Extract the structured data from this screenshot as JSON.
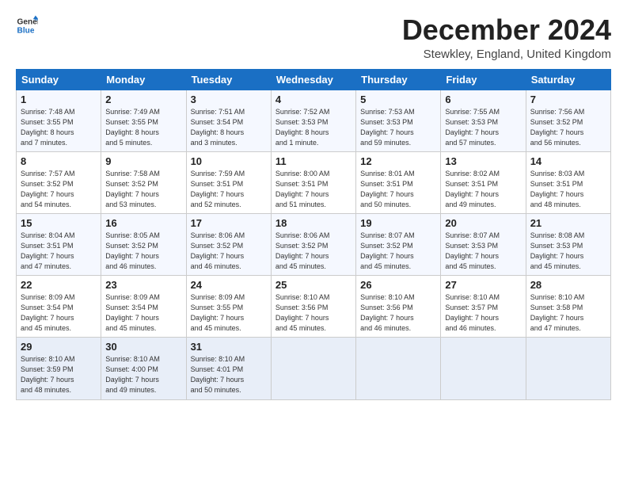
{
  "header": {
    "logo_line1": "General",
    "logo_line2": "Blue",
    "title": "December 2024",
    "location": "Stewkley, England, United Kingdom"
  },
  "days_of_week": [
    "Sunday",
    "Monday",
    "Tuesday",
    "Wednesday",
    "Thursday",
    "Friday",
    "Saturday"
  ],
  "weeks": [
    [
      {
        "day": 1,
        "info": "Sunrise: 7:48 AM\nSunset: 3:55 PM\nDaylight: 8 hours\nand 7 minutes."
      },
      {
        "day": 2,
        "info": "Sunrise: 7:49 AM\nSunset: 3:55 PM\nDaylight: 8 hours\nand 5 minutes."
      },
      {
        "day": 3,
        "info": "Sunrise: 7:51 AM\nSunset: 3:54 PM\nDaylight: 8 hours\nand 3 minutes."
      },
      {
        "day": 4,
        "info": "Sunrise: 7:52 AM\nSunset: 3:53 PM\nDaylight: 8 hours\nand 1 minute."
      },
      {
        "day": 5,
        "info": "Sunrise: 7:53 AM\nSunset: 3:53 PM\nDaylight: 7 hours\nand 59 minutes."
      },
      {
        "day": 6,
        "info": "Sunrise: 7:55 AM\nSunset: 3:53 PM\nDaylight: 7 hours\nand 57 minutes."
      },
      {
        "day": 7,
        "info": "Sunrise: 7:56 AM\nSunset: 3:52 PM\nDaylight: 7 hours\nand 56 minutes."
      }
    ],
    [
      {
        "day": 8,
        "info": "Sunrise: 7:57 AM\nSunset: 3:52 PM\nDaylight: 7 hours\nand 54 minutes."
      },
      {
        "day": 9,
        "info": "Sunrise: 7:58 AM\nSunset: 3:52 PM\nDaylight: 7 hours\nand 53 minutes."
      },
      {
        "day": 10,
        "info": "Sunrise: 7:59 AM\nSunset: 3:51 PM\nDaylight: 7 hours\nand 52 minutes."
      },
      {
        "day": 11,
        "info": "Sunrise: 8:00 AM\nSunset: 3:51 PM\nDaylight: 7 hours\nand 51 minutes."
      },
      {
        "day": 12,
        "info": "Sunrise: 8:01 AM\nSunset: 3:51 PM\nDaylight: 7 hours\nand 50 minutes."
      },
      {
        "day": 13,
        "info": "Sunrise: 8:02 AM\nSunset: 3:51 PM\nDaylight: 7 hours\nand 49 minutes."
      },
      {
        "day": 14,
        "info": "Sunrise: 8:03 AM\nSunset: 3:51 PM\nDaylight: 7 hours\nand 48 minutes."
      }
    ],
    [
      {
        "day": 15,
        "info": "Sunrise: 8:04 AM\nSunset: 3:51 PM\nDaylight: 7 hours\nand 47 minutes."
      },
      {
        "day": 16,
        "info": "Sunrise: 8:05 AM\nSunset: 3:52 PM\nDaylight: 7 hours\nand 46 minutes."
      },
      {
        "day": 17,
        "info": "Sunrise: 8:06 AM\nSunset: 3:52 PM\nDaylight: 7 hours\nand 46 minutes."
      },
      {
        "day": 18,
        "info": "Sunrise: 8:06 AM\nSunset: 3:52 PM\nDaylight: 7 hours\nand 45 minutes."
      },
      {
        "day": 19,
        "info": "Sunrise: 8:07 AM\nSunset: 3:52 PM\nDaylight: 7 hours\nand 45 minutes."
      },
      {
        "day": 20,
        "info": "Sunrise: 8:07 AM\nSunset: 3:53 PM\nDaylight: 7 hours\nand 45 minutes."
      },
      {
        "day": 21,
        "info": "Sunrise: 8:08 AM\nSunset: 3:53 PM\nDaylight: 7 hours\nand 45 minutes."
      }
    ],
    [
      {
        "day": 22,
        "info": "Sunrise: 8:09 AM\nSunset: 3:54 PM\nDaylight: 7 hours\nand 45 minutes."
      },
      {
        "day": 23,
        "info": "Sunrise: 8:09 AM\nSunset: 3:54 PM\nDaylight: 7 hours\nand 45 minutes."
      },
      {
        "day": 24,
        "info": "Sunrise: 8:09 AM\nSunset: 3:55 PM\nDaylight: 7 hours\nand 45 minutes."
      },
      {
        "day": 25,
        "info": "Sunrise: 8:10 AM\nSunset: 3:56 PM\nDaylight: 7 hours\nand 45 minutes."
      },
      {
        "day": 26,
        "info": "Sunrise: 8:10 AM\nSunset: 3:56 PM\nDaylight: 7 hours\nand 46 minutes."
      },
      {
        "day": 27,
        "info": "Sunrise: 8:10 AM\nSunset: 3:57 PM\nDaylight: 7 hours\nand 46 minutes."
      },
      {
        "day": 28,
        "info": "Sunrise: 8:10 AM\nSunset: 3:58 PM\nDaylight: 7 hours\nand 47 minutes."
      }
    ],
    [
      {
        "day": 29,
        "info": "Sunrise: 8:10 AM\nSunset: 3:59 PM\nDaylight: 7 hours\nand 48 minutes."
      },
      {
        "day": 30,
        "info": "Sunrise: 8:10 AM\nSunset: 4:00 PM\nDaylight: 7 hours\nand 49 minutes."
      },
      {
        "day": 31,
        "info": "Sunrise: 8:10 AM\nSunset: 4:01 PM\nDaylight: 7 hours\nand 50 minutes."
      },
      null,
      null,
      null,
      null
    ]
  ]
}
